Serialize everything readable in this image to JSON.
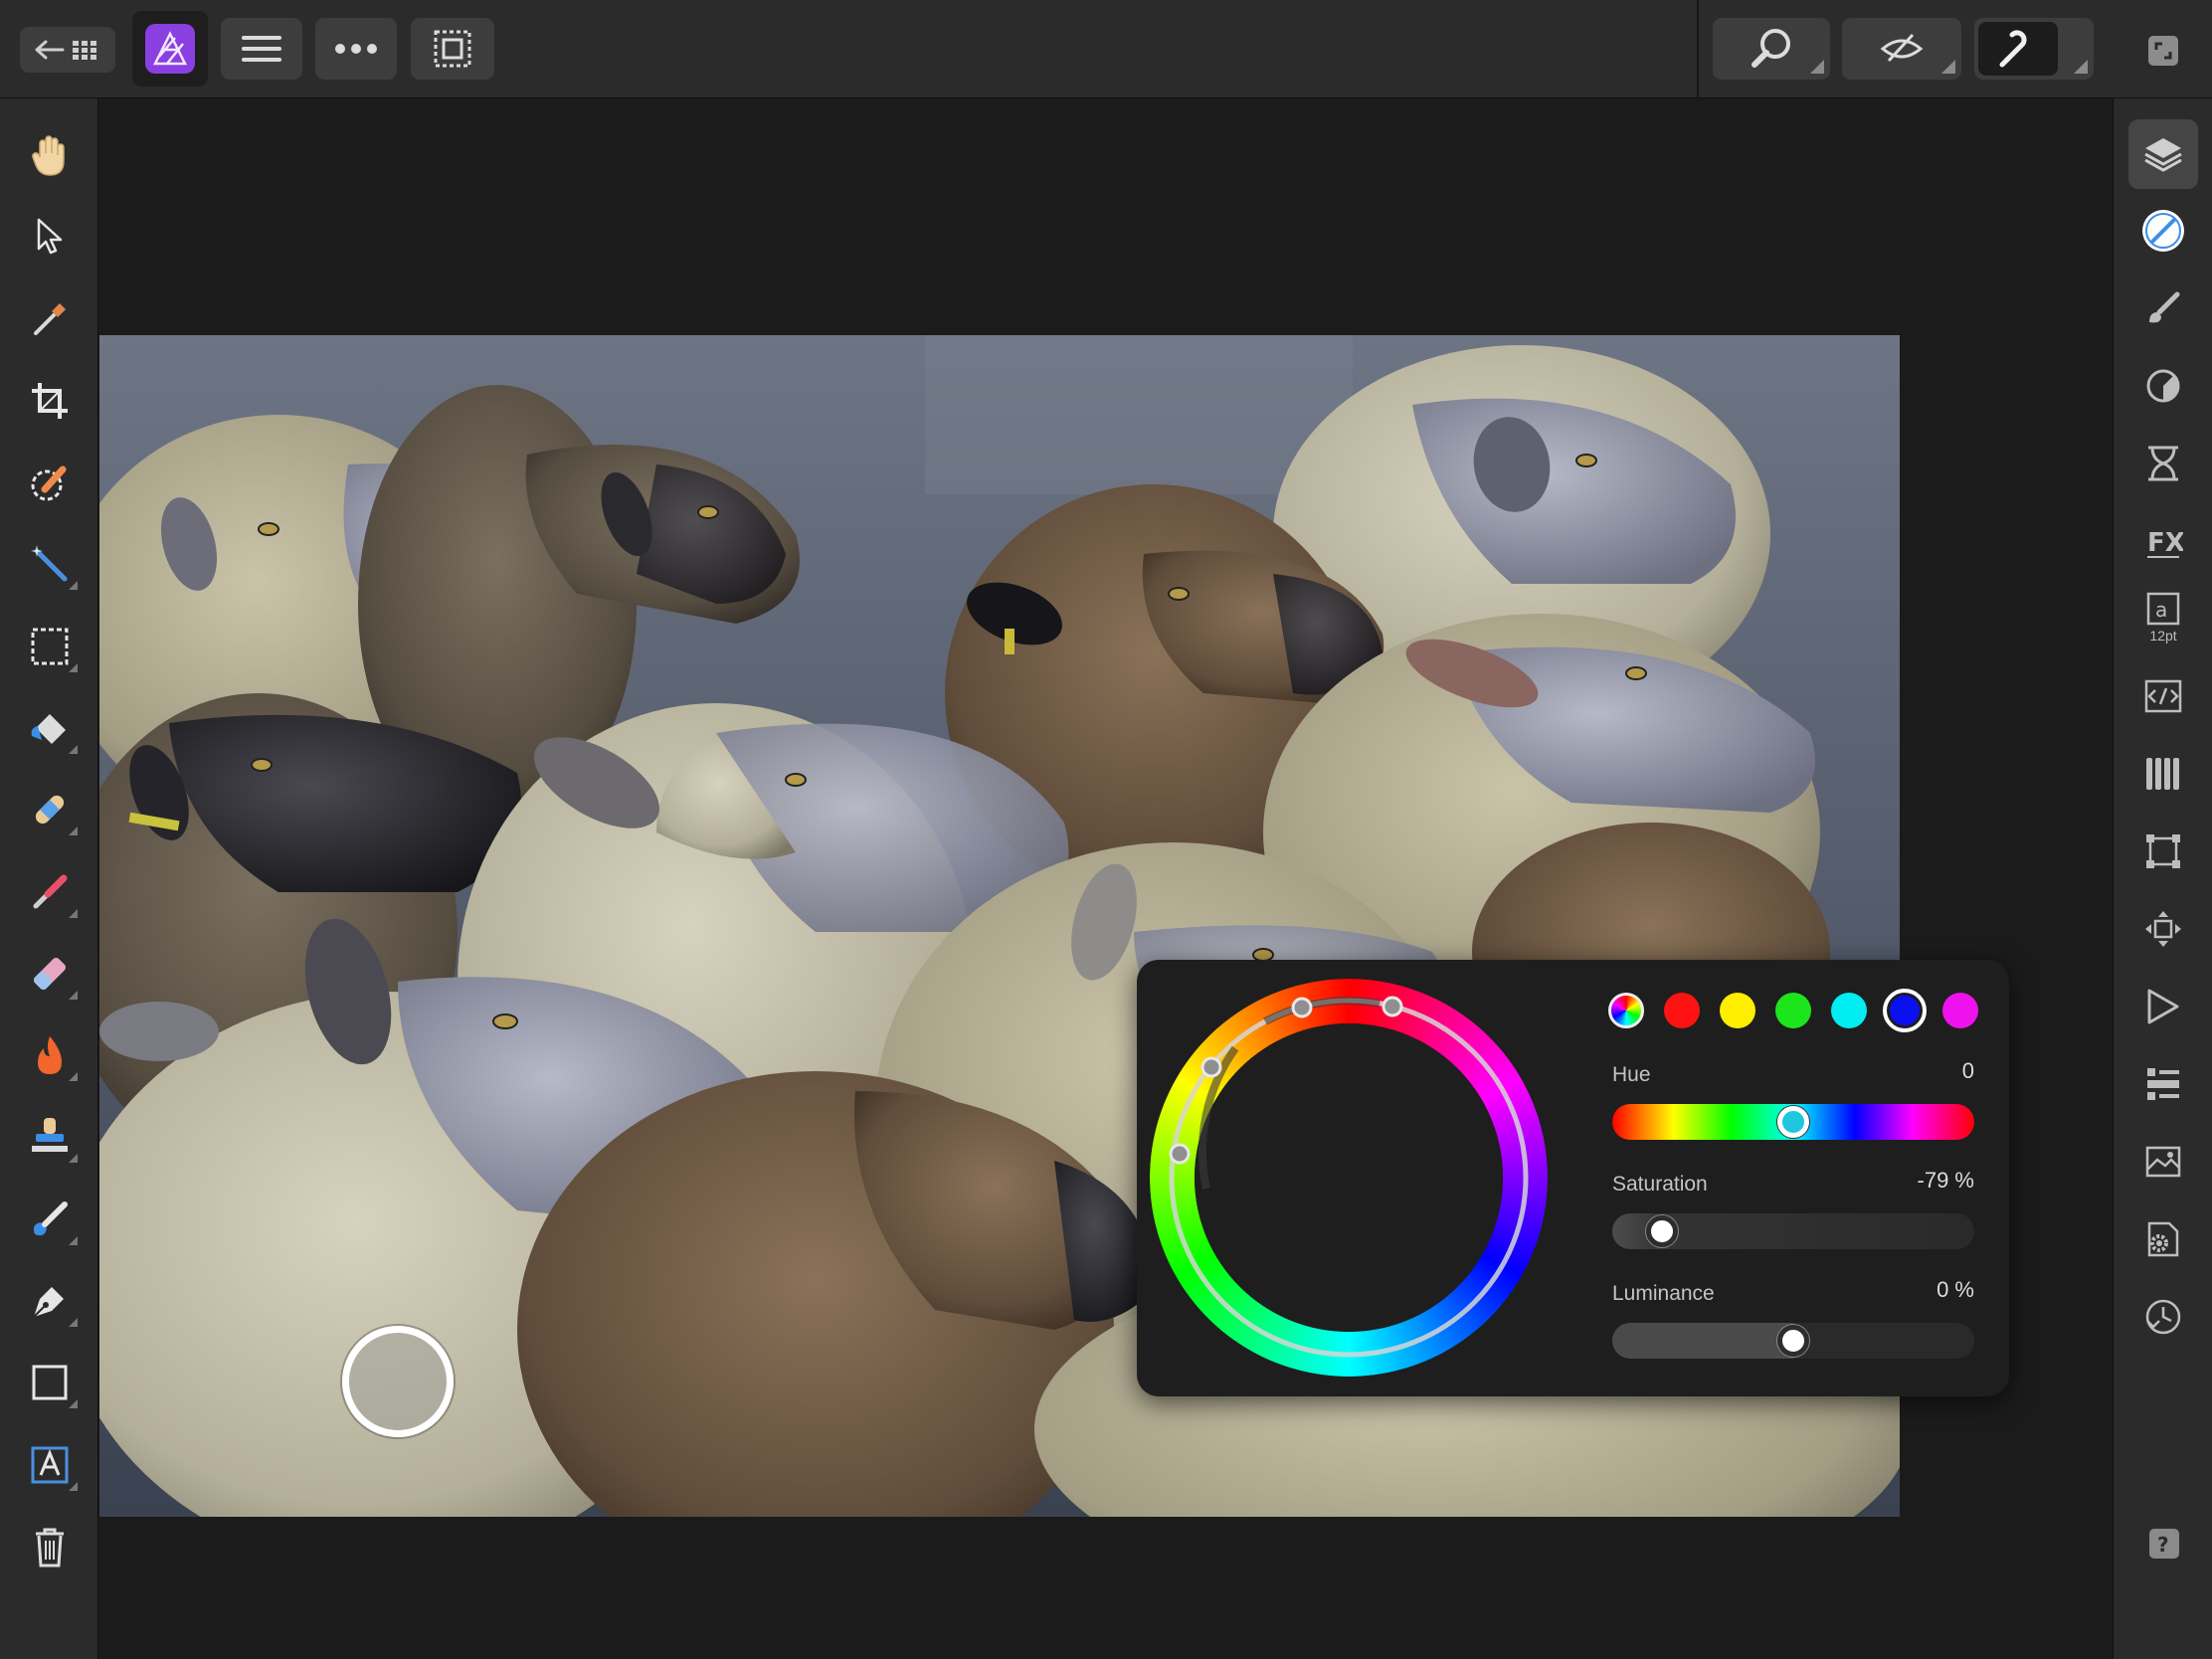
{
  "app": {
    "name": "Affinity Photo"
  },
  "topbar": {
    "back_icon": "back-to-home-icon",
    "app_icon": "affinity-photo-icon",
    "menu_icon": "hamburger-menu-icon",
    "more_icon": "more-icon",
    "selection_icon": "selection-mode-icon",
    "zoom_icon": "zoom-view-icon",
    "view_icon": "view-mode-icon",
    "snapping_icon": "snapping-icon",
    "fullscreen_icon": "fullscreen-icon"
  },
  "tools": [
    "hand-tool-icon",
    "move-tool-icon",
    "color-picker-tool-icon",
    "crop-tool-icon",
    "selection-brush-tool-icon",
    "flood-select-tool-icon",
    "rectangular-marquee-tool-icon",
    "flood-fill-tool-icon",
    "healing-brush-tool-icon",
    "paint-brush-tool-icon",
    "erase-brush-tool-icon",
    "dodge-burn-tool-icon",
    "clone-stamp-tool-icon",
    "smudge-tool-icon",
    "pen-tool-icon",
    "rectangle-shape-tool-icon",
    "artistic-text-tool-icon",
    "delete-icon"
  ],
  "studio": {
    "text_panel_size": "12pt",
    "panels": [
      "layers-panel-icon",
      "color-panel-icon",
      "brushes-panel-icon",
      "adjustments-panel-icon",
      "live-filters-panel-icon",
      "fx-panel-icon",
      "text-panel-icon",
      "macros-panel-icon",
      "channels-panel-icon",
      "transform-panel-icon",
      "navigator-panel-icon",
      "history-panel-icon",
      "stock-panel-icon",
      "styles-panel-icon",
      "settings-panel-icon",
      "timeline-panel-icon"
    ],
    "help_icon": "help-icon"
  },
  "color_popup": {
    "swatches": [
      {
        "name": "all-colors",
        "color": "spectrum"
      },
      {
        "name": "red",
        "color": "#ff1212"
      },
      {
        "name": "yellow",
        "color": "#ffee00"
      },
      {
        "name": "green",
        "color": "#1ce51c"
      },
      {
        "name": "cyan",
        "color": "#00eef2"
      },
      {
        "name": "blue",
        "color": "#0b10f0",
        "selected": true
      },
      {
        "name": "magenta",
        "color": "#ee12ee"
      }
    ],
    "hue": {
      "label": "Hue",
      "value": "0",
      "position": 0.5
    },
    "saturation": {
      "label": "Saturation",
      "value": "-79 %",
      "position": 0.14
    },
    "luminance": {
      "label": "Luminance",
      "value": "0 %",
      "position": 0.5
    }
  },
  "colors": {
    "background": "#1b1b1b",
    "chrome": "#2b2b2b",
    "button": "#3d3d3d",
    "accent": "#7a3fd4"
  }
}
